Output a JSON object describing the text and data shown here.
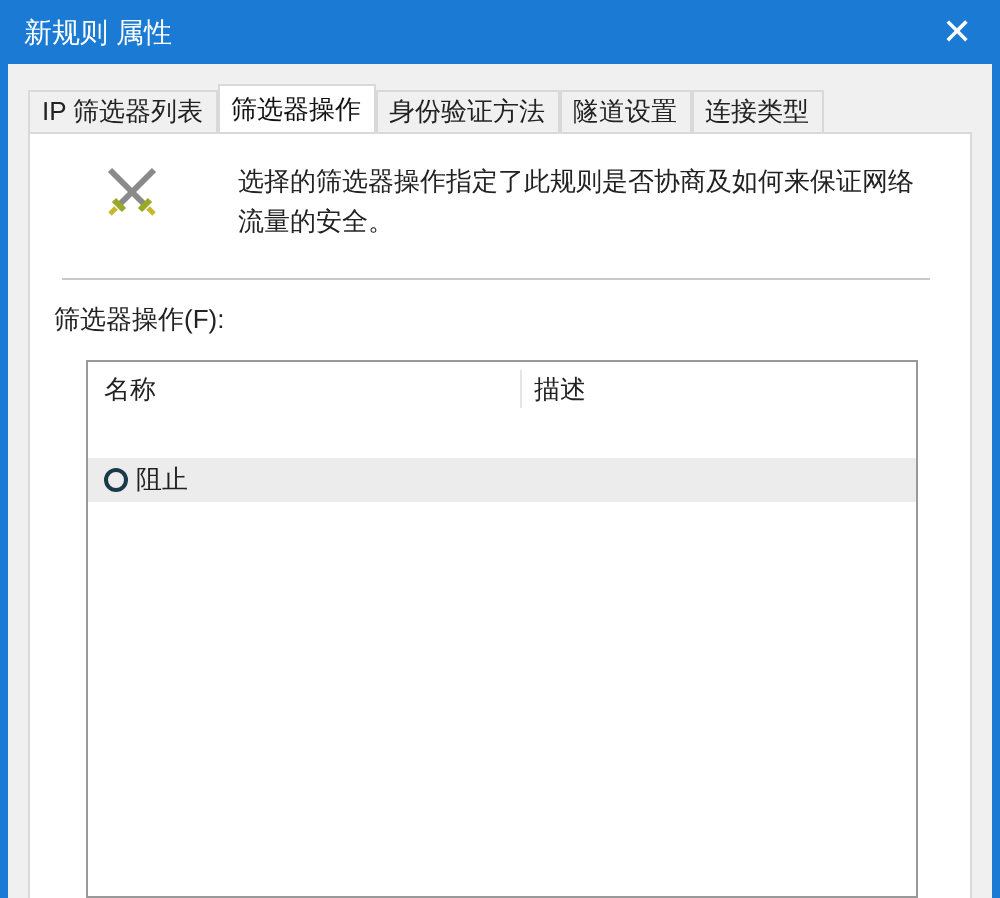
{
  "window": {
    "title": "新规则 属性",
    "close": "✕"
  },
  "tabs": [
    {
      "label": "IP 筛选器列表",
      "selected": false
    },
    {
      "label": "筛选器操作",
      "selected": true
    },
    {
      "label": "身份验证方法",
      "selected": false
    },
    {
      "label": "隧道设置",
      "selected": false
    },
    {
      "label": "连接类型",
      "selected": false
    }
  ],
  "description": "选择的筛选器操作指定了此规则是否协商及如何来保证网络流量的安全。",
  "list_label": "筛选器操作(F):",
  "table": {
    "columns": [
      "名称",
      "描述"
    ],
    "rows": [
      {
        "name": "阻止",
        "selected": true,
        "checked": false
      }
    ]
  }
}
